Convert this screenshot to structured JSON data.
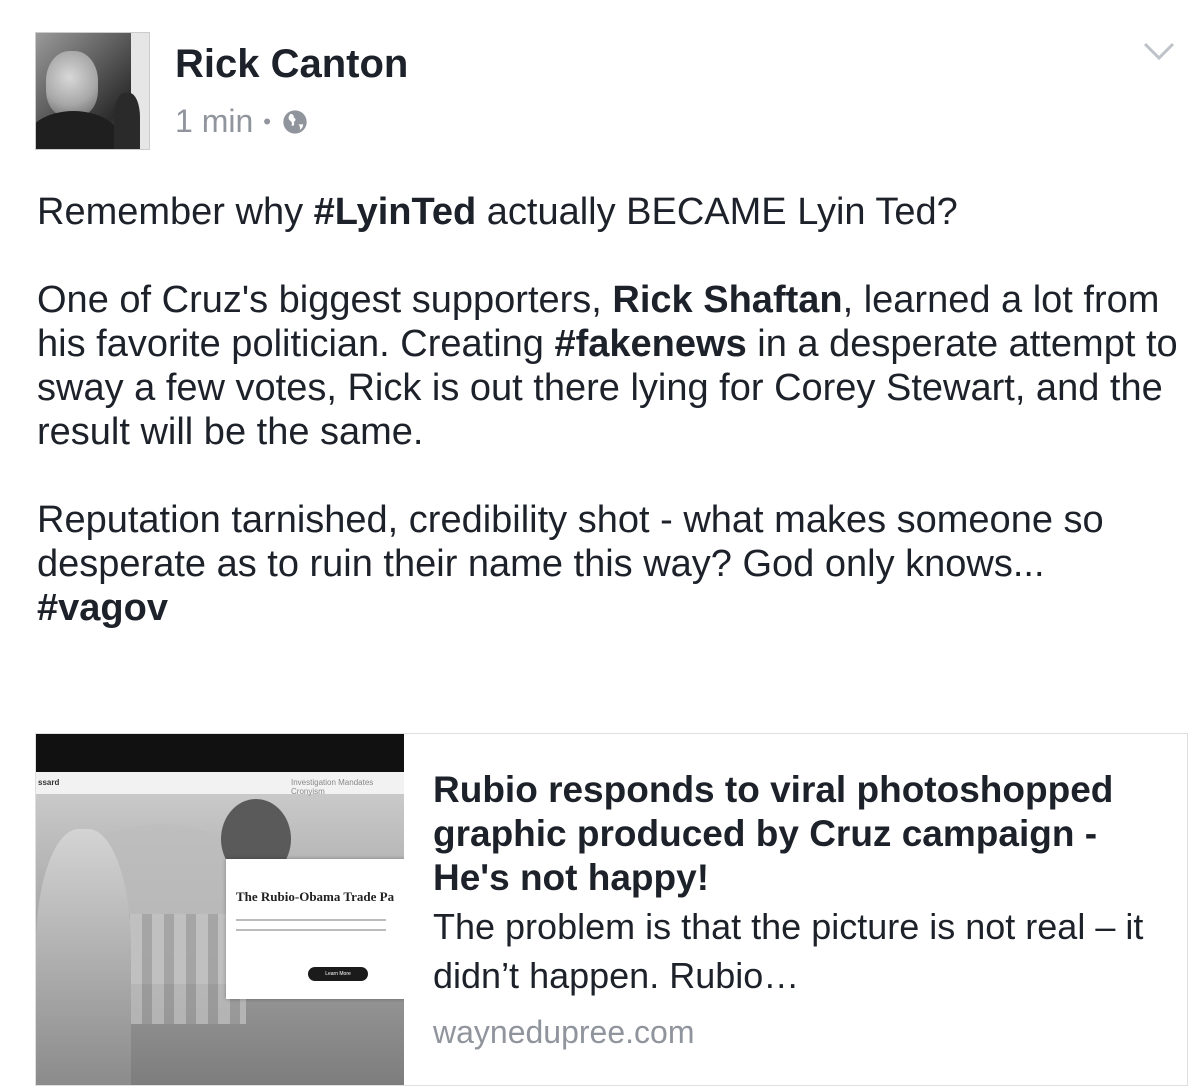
{
  "post": {
    "author": "Rick Canton",
    "timestamp": "1 min",
    "separator": "•",
    "privacy_icon": "globe-icon",
    "menu_icon": "chevron-down-icon",
    "text": {
      "p1_before": "Remember why ",
      "p1_hashtag": "#LyinTed",
      "p1_after": " actually BECAME Lyin Ted?",
      "p2_before": "One of Cruz's biggest supporters, ",
      "p2_name": "Rick Shaftan",
      "p2_mid": ", learned a lot from his favorite politician. Creating ",
      "p2_hashtag": "#fakenews",
      "p2_after": " in a desperate attempt to sway a few votes, Rick is out there lying for Corey Stewart, and the result will be the same.",
      "p3": "Reputation tarnished, credibility shot - what makes someone so desperate as to ruin their name this way? God only knows...",
      "p3_hashtag": "#vagov"
    }
  },
  "link_card": {
    "title": "Rubio responds to viral photoshopped graphic produced by Cruz campaign - He's not happy!",
    "description": "The problem is that the picture is not real – it didn’t happen. Rubio…",
    "domain": "waynedupree.com",
    "thumbnail": {
      "site_logo": "ssard",
      "nav_links": "Investigation   Mandates   Cronyism",
      "overlay_title": "The Rubio-Obama Trade Pa",
      "button_label": "Learn More"
    }
  }
}
